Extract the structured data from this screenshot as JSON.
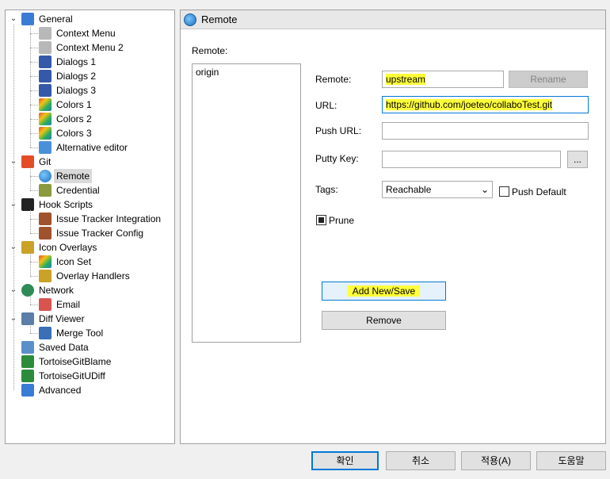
{
  "tree": {
    "items": [
      {
        "label": "General",
        "icon": "wrench-icon",
        "level": 0,
        "expanded": true
      },
      {
        "label": "Context Menu",
        "icon": "gear-icon",
        "level": 1
      },
      {
        "label": "Context Menu 2",
        "icon": "gear-icon",
        "level": 1
      },
      {
        "label": "Dialogs 1",
        "icon": "window-icon",
        "level": 1
      },
      {
        "label": "Dialogs 2",
        "icon": "window-icon",
        "level": 1
      },
      {
        "label": "Dialogs 3",
        "icon": "window-icon",
        "level": 1
      },
      {
        "label": "Colors 1",
        "icon": "palette-icon",
        "level": 1
      },
      {
        "label": "Colors 2",
        "icon": "palette-icon",
        "level": 1
      },
      {
        "label": "Colors 3",
        "icon": "palette-icon",
        "level": 1
      },
      {
        "label": "Alternative editor",
        "icon": "editor-icon",
        "level": 1
      },
      {
        "label": "Git",
        "icon": "git-icon",
        "level": 0,
        "expanded": true
      },
      {
        "label": "Remote",
        "icon": "globe-icon",
        "level": 1,
        "selected": true
      },
      {
        "label": "Credential",
        "icon": "credential-icon",
        "level": 1
      },
      {
        "label": "Hook Scripts",
        "icon": "hook-icon",
        "level": 0,
        "expanded": true
      },
      {
        "label": "Issue Tracker Integration",
        "icon": "bug-icon",
        "level": 1
      },
      {
        "label": "Issue Tracker Config",
        "icon": "bug-icon",
        "level": 1
      },
      {
        "label": "Icon Overlays",
        "icon": "overlay-icon",
        "level": 0,
        "expanded": true
      },
      {
        "label": "Icon Set",
        "icon": "palette-icon",
        "level": 1
      },
      {
        "label": "Overlay Handlers",
        "icon": "overlay-icon",
        "level": 1
      },
      {
        "label": "Network",
        "icon": "network-icon",
        "level": 0,
        "expanded": true
      },
      {
        "label": "Email",
        "icon": "email-icon",
        "level": 1
      },
      {
        "label": "Diff Viewer",
        "icon": "magnifier-icon",
        "level": 0,
        "expanded": true
      },
      {
        "label": "Merge Tool",
        "icon": "merge-icon",
        "level": 1
      },
      {
        "label": "Saved Data",
        "icon": "saved-data-icon",
        "level": 0
      },
      {
        "label": "TortoiseGitBlame",
        "icon": "blame-icon",
        "level": 0
      },
      {
        "label": "TortoiseGitUDiff",
        "icon": "udiff-icon",
        "level": 0
      },
      {
        "label": "Advanced",
        "icon": "wrench-icon",
        "level": 0
      }
    ]
  },
  "panel": {
    "title": "Remote",
    "remote_list_label": "Remote:",
    "remotes": [
      "origin"
    ],
    "remote_label": "Remote:",
    "remote_value": "upstream",
    "rename_label": "Rename",
    "url_label": "URL:",
    "url_value": "https://github.com/joeteo/collaboTest.git",
    "push_url_label": "Push URL:",
    "push_url_value": "",
    "putty_key_label": "Putty Key:",
    "putty_key_value": "",
    "browse_label": "...",
    "tags_label": "Tags:",
    "tags_value": "Reachable",
    "push_default_label": "Push Default",
    "prune_label": "Prune",
    "add_save_label": "Add New/Save",
    "remove_label": "Remove"
  },
  "footer": {
    "ok_label": "확인",
    "cancel_label": "취소",
    "apply_label": "적용(A)",
    "help_label": "도움말"
  },
  "colors": {
    "highlight": "#ffff3a",
    "accent": "#0078d7"
  }
}
